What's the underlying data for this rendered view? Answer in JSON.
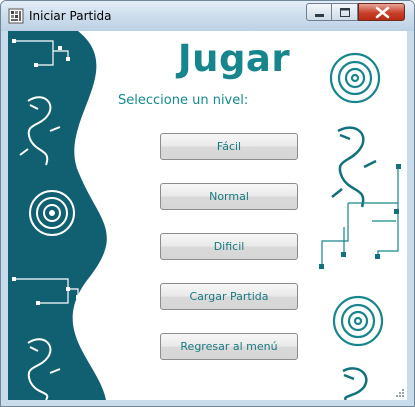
{
  "window": {
    "title": "Iniciar Partida"
  },
  "main": {
    "heading": "Jugar",
    "prompt": "Seleccione un nivel:",
    "buttons": [
      {
        "label": "Fácil"
      },
      {
        "label": "Normal"
      },
      {
        "label": "Dificil"
      },
      {
        "label": "Cargar Partida"
      },
      {
        "label": "Regresar al menú"
      }
    ]
  },
  "colors": {
    "panel": "#116071",
    "accent": "#16868c"
  },
  "icons": [
    "app-icon",
    "minimize-icon",
    "maximize-icon",
    "close-icon",
    "dragon-icon",
    "spiral-icon",
    "circuit-icon",
    "resize-grip-icon"
  ]
}
